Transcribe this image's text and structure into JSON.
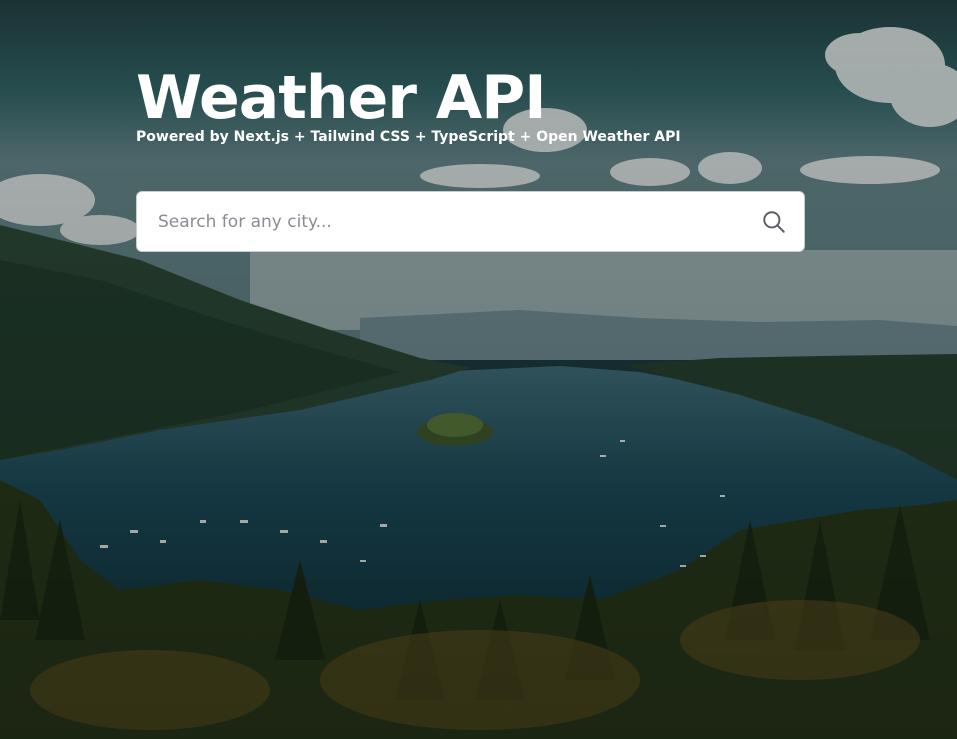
{
  "header": {
    "title": "Weather API",
    "subtitle": "Powered by Next.js + Tailwind CSS + TypeScript + Open Weather API"
  },
  "search": {
    "placeholder": "Search for any city...",
    "value": ""
  },
  "icons": {
    "search": "search-icon"
  },
  "colors": {
    "title_text": "#ffffff",
    "input_background": "#ffffff",
    "placeholder_text": "#8b8b95",
    "icon_stroke": "#5d5d66"
  }
}
